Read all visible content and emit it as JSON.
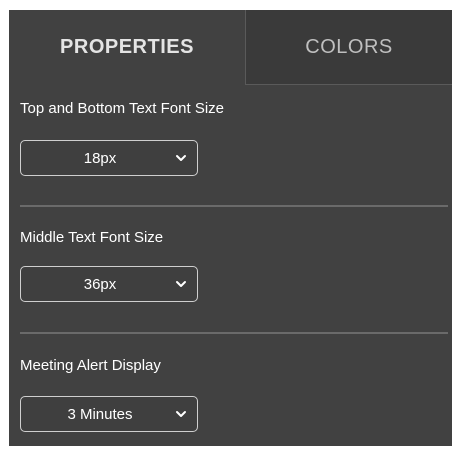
{
  "tabs": [
    {
      "label": "PROPERTIES",
      "active": true
    },
    {
      "label": "COLORS",
      "active": false
    }
  ],
  "fields": [
    {
      "label": "Top and Bottom Text Font Size",
      "value": "18px"
    },
    {
      "label": "Middle Text Font Size",
      "value": "36px"
    },
    {
      "label": "Meeting Alert Display",
      "value": "3 Minutes"
    }
  ],
  "colors": {
    "panel_bg": "#414141",
    "inactive_tab_bg": "#3a3a3a",
    "text": "#ffffff"
  },
  "icons": {
    "dropdown": "chevron-down-icon"
  }
}
